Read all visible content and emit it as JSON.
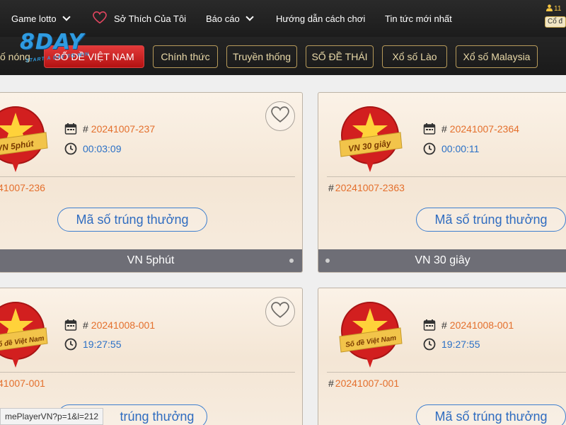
{
  "nav": {
    "items": [
      {
        "label": "Game lotto",
        "has_chevron": true
      },
      {
        "label": "Sở Thích Của Tôi",
        "icon": "heart-icon"
      },
      {
        "label": "Báo cáo",
        "has_chevron": true
      },
      {
        "label": "Hướng dẫn cách chơi"
      },
      {
        "label": "Tin tức mới nhất"
      }
    ],
    "user": {
      "balance_partial": "11",
      "button_partial": "Cổ đ"
    }
  },
  "logo": {
    "main": "8DAY",
    "sub": "START A DAY TO WIN"
  },
  "categories": [
    {
      "label": "ố nóng",
      "state": "partial"
    },
    {
      "label": "SỐ ĐỀ VIỆT NAM",
      "state": "active"
    },
    {
      "label": "Chính thức",
      "state": "normal"
    },
    {
      "label": "Truyền thống",
      "state": "normal"
    },
    {
      "label": "SỐ ĐỀ THÁI",
      "state": "normal"
    },
    {
      "label": "Xổ số Lào",
      "state": "normal"
    },
    {
      "label": "Xổ số Malaysia",
      "state": "normal"
    }
  ],
  "cards": [
    {
      "badge": "VN 5phút",
      "current_issue": "20241007-237",
      "countdown": "00:03:09",
      "previous_issue": "41007-236",
      "win_button": "Mã số trúng thưởng",
      "footer": "VN 5phút",
      "favorite": true
    },
    {
      "badge": "VN 30 giây",
      "current_issue": "20241007-2364",
      "countdown": "00:00:11",
      "previous_issue": "20241007-2363",
      "win_button": "Mã số trúng thưởng",
      "footer": "VN 30 giây",
      "favorite": false
    },
    {
      "badge": "ổ đề Việt Nam",
      "current_issue": "20241008-001",
      "countdown": "19:27:55",
      "previous_issue": "41007-001",
      "win_button": "trúng thưởng",
      "footer": "",
      "favorite": true
    },
    {
      "badge": "Số đề Việt Nam",
      "current_issue": "20241008-001",
      "countdown": "19:27:55",
      "previous_issue": "20241007-001",
      "win_button": "Mã số trúng thưởng",
      "footer": "",
      "favorite": false
    }
  ],
  "labels": {
    "hash": "#"
  },
  "statusbar": {
    "url": "mePlayerVN?p=1&l=212"
  },
  "colors": {
    "accent_red": "#c81b1b",
    "issue_orange": "#e46f2c",
    "time_blue": "#2a70c6",
    "gold": "#b69a5a"
  }
}
